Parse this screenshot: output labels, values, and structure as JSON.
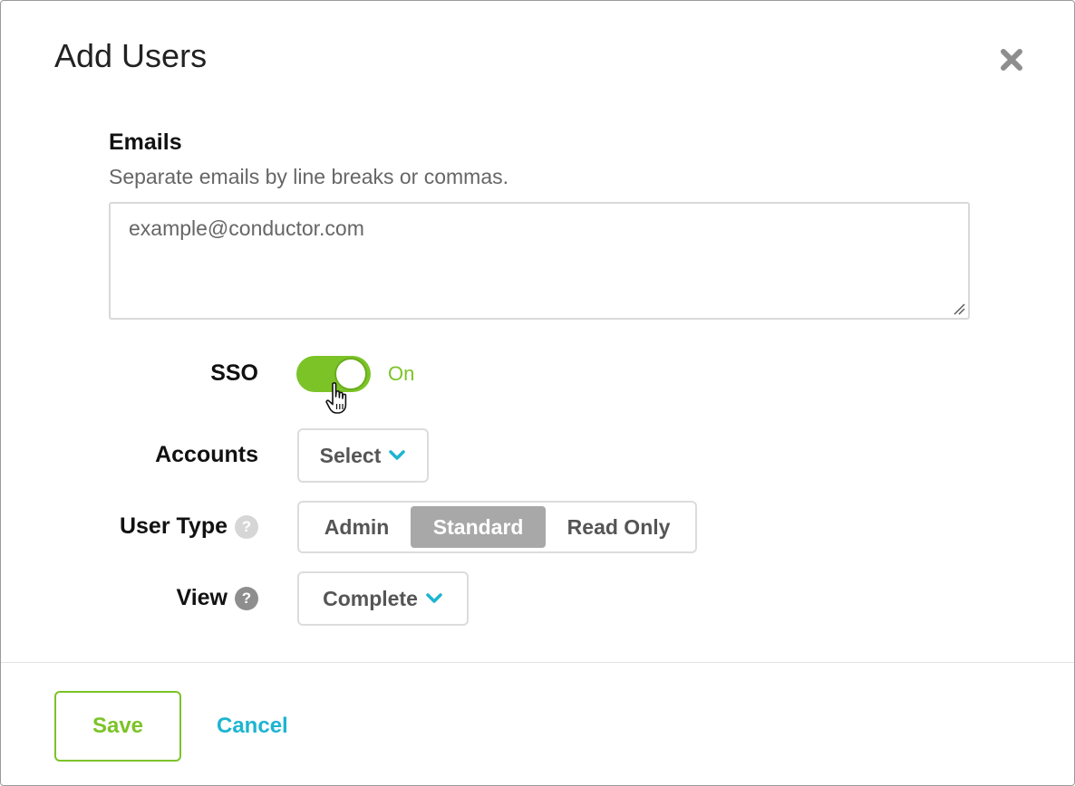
{
  "dialog": {
    "title": "Add Users"
  },
  "emails": {
    "label": "Emails",
    "help": "Separate emails by line breaks or commas.",
    "placeholder": "example@conductor.com"
  },
  "sso": {
    "label": "SSO",
    "status": "On",
    "enabled": true
  },
  "accounts": {
    "label": "Accounts",
    "value": "Select"
  },
  "user_type": {
    "label": "User Type",
    "options": [
      "Admin",
      "Standard",
      "Read Only"
    ],
    "selected": "Standard"
  },
  "view": {
    "label": "View",
    "value": "Complete"
  },
  "footer": {
    "save_label": "Save",
    "cancel_label": "Cancel"
  },
  "colors": {
    "accent_green": "#7cc328",
    "link_blue": "#1cb5d0",
    "selected_segment": "#a8a8a8"
  },
  "icons": {
    "close": "close-icon",
    "help": "help-icon",
    "chevron": "chevron-down-icon",
    "cursor": "hand-cursor-icon"
  }
}
